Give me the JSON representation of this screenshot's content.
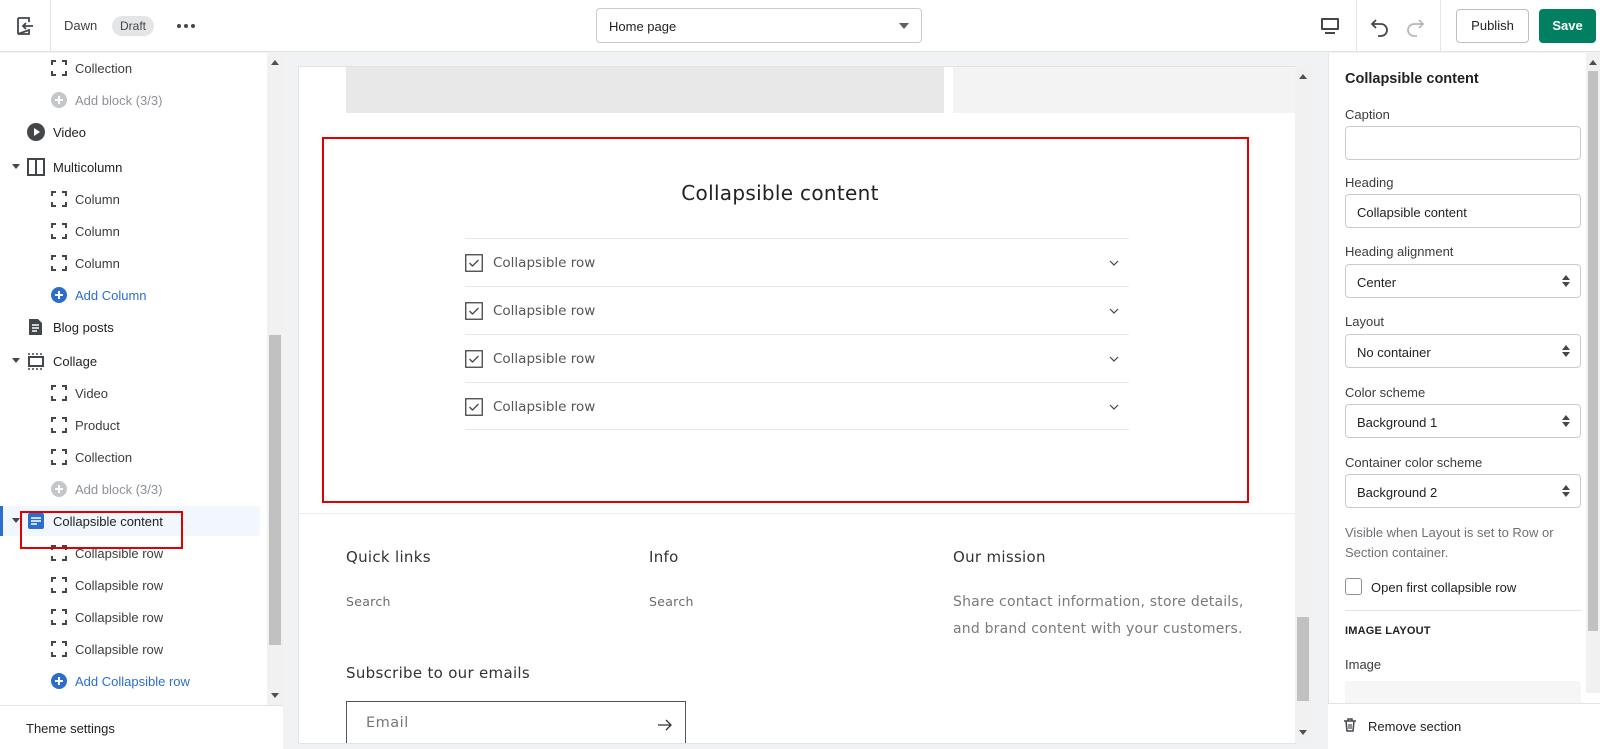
{
  "topbar": {
    "theme_name": "Dawn",
    "status_badge": "Draft",
    "page_select": "Home page",
    "publish_label": "Publish",
    "save_label": "Save",
    "accent_color": "#008060"
  },
  "sidebar": {
    "items": [
      {
        "label": "Collection",
        "kind": "block",
        "icon": "block-icon"
      },
      {
        "label": "Add block (3/3)",
        "kind": "add-disabled",
        "icon": "add-circle-icon"
      },
      {
        "label": "Video",
        "kind": "section",
        "icon": "play-icon"
      },
      {
        "label": "Multicolumn",
        "kind": "section",
        "icon": "multicolumn-icon"
      },
      {
        "label": "Column",
        "kind": "block",
        "icon": "block-icon"
      },
      {
        "label": "Column",
        "kind": "block",
        "icon": "block-icon"
      },
      {
        "label": "Column",
        "kind": "block",
        "icon": "block-icon"
      },
      {
        "label": "Add Column",
        "kind": "add",
        "icon": "add-circle-icon"
      },
      {
        "label": "Blog posts",
        "kind": "section",
        "icon": "blog-icon"
      },
      {
        "label": "Collage",
        "kind": "section",
        "icon": "collage-icon"
      },
      {
        "label": "Video",
        "kind": "block",
        "icon": "block-icon"
      },
      {
        "label": "Product",
        "kind": "block",
        "icon": "block-icon"
      },
      {
        "label": "Collection",
        "kind": "block",
        "icon": "block-icon"
      },
      {
        "label": "Add block (3/3)",
        "kind": "add-disabled",
        "icon": "add-circle-icon"
      },
      {
        "label": "Collapsible content",
        "kind": "section",
        "icon": "collapsible-icon",
        "selected": true
      },
      {
        "label": "Collapsible row",
        "kind": "block",
        "icon": "block-icon"
      },
      {
        "label": "Collapsible row",
        "kind": "block",
        "icon": "block-icon"
      },
      {
        "label": "Collapsible row",
        "kind": "block",
        "icon": "block-icon"
      },
      {
        "label": "Collapsible row",
        "kind": "block",
        "icon": "block-icon"
      },
      {
        "label": "Add Collapsible row",
        "kind": "add",
        "icon": "add-circle-icon"
      }
    ],
    "theme_settings": "Theme settings"
  },
  "preview": {
    "section_title": "Collapsible content",
    "rows": [
      "Collapsible row",
      "Collapsible row",
      "Collapsible row",
      "Collapsible row"
    ],
    "footer": {
      "quick_links": {
        "heading": "Quick links",
        "link": "Search"
      },
      "info": {
        "heading": "Info",
        "link": "Search"
      },
      "mission": {
        "heading": "Our mission",
        "text": "Share contact information, store details, and brand content with your customers."
      },
      "subscribe_heading": "Subscribe to our emails",
      "email_placeholder": "Email"
    }
  },
  "inspector": {
    "title": "Collapsible content",
    "caption": {
      "label": "Caption",
      "value": ""
    },
    "heading": {
      "label": "Heading",
      "value": "Collapsible content"
    },
    "heading_alignment": {
      "label": "Heading alignment",
      "value": "Center"
    },
    "layout": {
      "label": "Layout",
      "value": "No container"
    },
    "color_scheme": {
      "label": "Color scheme",
      "value": "Background 1"
    },
    "container_color_scheme": {
      "label": "Container color scheme",
      "value": "Background 2"
    },
    "help_text": "Visible when Layout is set to Row or Section container.",
    "open_first_row": {
      "label": "Open first collapsible row",
      "checked": false
    },
    "image_layout_heading": "IMAGE LAYOUT",
    "image_label": "Image",
    "remove_section": "Remove section"
  }
}
